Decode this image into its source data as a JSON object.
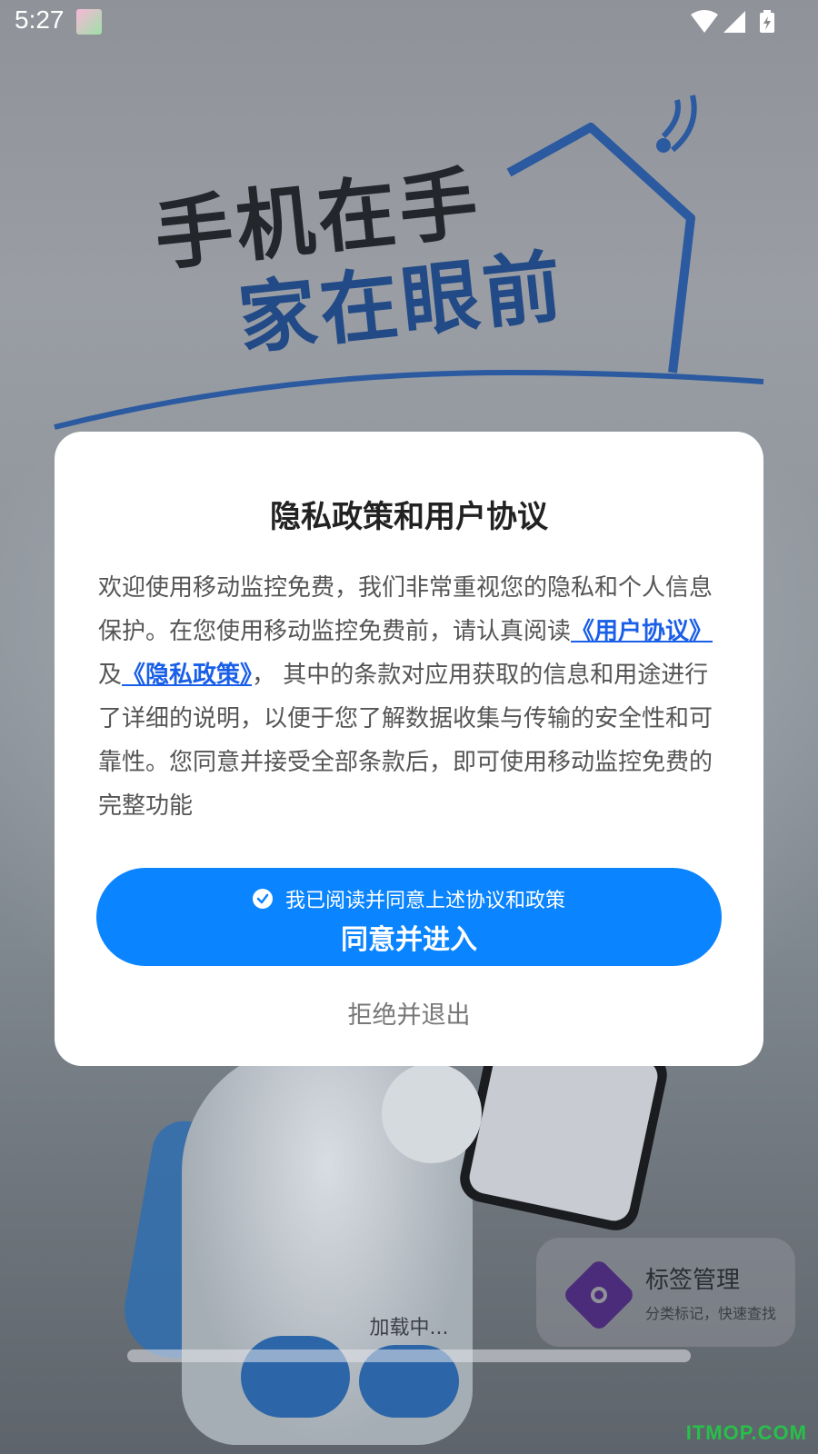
{
  "status_bar": {
    "time": "5:27"
  },
  "splash": {
    "slogan_line1": "手机在手",
    "slogan_line2": "家在眼前",
    "feature_card": {
      "title": "标签管理",
      "subtitle": "分类标记，快速查找"
    },
    "loading_text": "加载中..."
  },
  "dialog": {
    "title": "隐私政策和用户协议",
    "body_part1": "欢迎使用移动监控免费，我们非常重视您的隐私和个人信息保护。在您使用移动监控免费前，请认真阅读",
    "user_agreement_link": "《用户协议》",
    "connector": "及",
    "privacy_policy_link": "《隐私政策》",
    "body_part2": "， 其中的条款对应用获取的信息和用途进行了详细的说明，以便于您了解数据收集与传输的安全性和可靠性。您同意并接受全部条款后，即可使用移动监控免费的完整功能",
    "checkbox_label": "我已阅读并同意上述协议和政策",
    "agree_button": "同意并进入",
    "reject_button": "拒绝并退出"
  },
  "watermark": "ITMOP.COM",
  "colors": {
    "primary_button": "#0a84ff",
    "link": "#1a5fe8",
    "dialog_bg": "#ffffff",
    "watermark": "#27c04a"
  }
}
